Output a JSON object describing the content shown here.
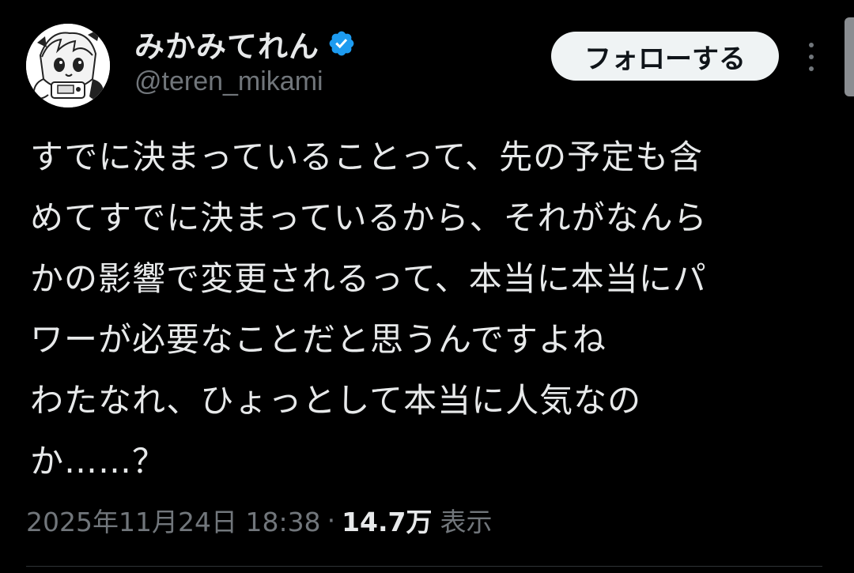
{
  "author": {
    "display_name": "みかみてれん",
    "handle": "@teren_mikami",
    "verified": true,
    "avatar_icon": "illustrated-character-avatar"
  },
  "actions": {
    "follow_label": "フォローする",
    "more_icon": "more-vertical-icon"
  },
  "tweet": {
    "lines": [
      "すでに決まっていることって、先の予定も含",
      "めてすでに決まっているから、それがなんら",
      "かの影響で変更されるって、本当に本当にパ",
      "ワーが必要なことだと思うんですよね",
      "わたなれ、ひょっとして本当に人気なの",
      "か……？"
    ]
  },
  "meta": {
    "timestamp": "2025年11月24日 18:38",
    "separator": "·",
    "views_count": "14.7万",
    "views_label": "表示"
  },
  "colors": {
    "background": "#000000",
    "text_primary": "#e7e9ea",
    "text_secondary": "#71767b",
    "verified_blue": "#1d9bf0",
    "button_bg": "#eff3f4"
  }
}
